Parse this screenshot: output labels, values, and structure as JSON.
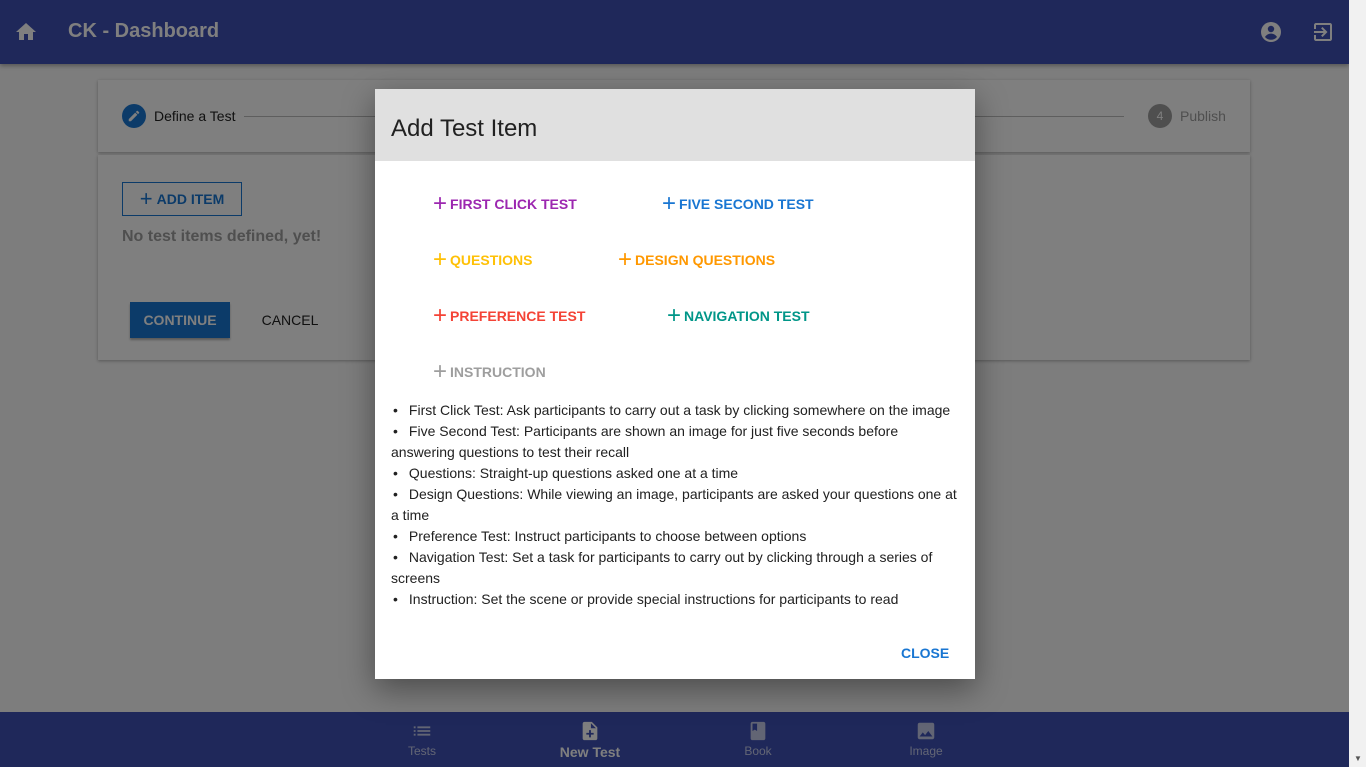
{
  "appbar": {
    "title": "CK - Dashboard"
  },
  "stepper": {
    "step1_label": "Define a Test",
    "step4_number": "4",
    "step4_label": "Publish"
  },
  "content": {
    "add_item_label": "ADD ITEM",
    "empty_text": "No test items defined, yet!",
    "continue_label": "CONTINUE",
    "cancel_label": "CANCEL"
  },
  "bottom_nav": [
    {
      "label": "Tests",
      "icon": "list-icon"
    },
    {
      "label": "New Test",
      "icon": "note-add-icon"
    },
    {
      "label": "Book",
      "icon": "book-icon"
    },
    {
      "label": "Image",
      "icon": "image-icon"
    }
  ],
  "dialog": {
    "title": "Add Test Item",
    "buttons": {
      "first_click": "FIRST CLICK TEST",
      "five_second": "FIVE SECOND TEST",
      "questions": "QUESTIONS",
      "design_questions": "DESIGN QUESTIONS",
      "preference": "PREFERENCE TEST",
      "navigation": "NAVIGATION TEST",
      "instruction": "INSTRUCTION"
    },
    "descriptions": [
      "First Click Test: Ask participants to carry out a task by clicking somewhere on the image",
      "Five Second Test: Participants are shown an image for just five seconds before answering questions to test their recall",
      "Questions: Straight-up questions asked one at a time",
      "Design Questions: While viewing an image, participants are asked your questions one at a time",
      "Preference Test: Instruct participants to choose between options",
      "Navigation Test: Set a task for participants to carry out by clicking through a series of screens",
      "Instruction: Set the scene or provide special instructions for participants to read"
    ],
    "close_label": "CLOSE"
  },
  "colors": {
    "primary": "#3f51b5",
    "accent_blue": "#1976d2",
    "purple": "#9c27b0",
    "yellow": "#ffc107",
    "orange": "#ff9800",
    "red": "#f44336",
    "teal": "#009688",
    "gray": "#9e9e9e"
  }
}
